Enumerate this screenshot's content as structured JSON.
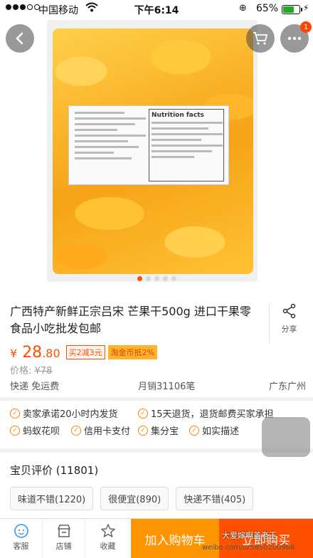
{
  "status_bar": {
    "carrier": "中国移动",
    "time": "下午6:14",
    "battery": "65%"
  },
  "nav": {
    "cart_badge": "1"
  },
  "gallery": {
    "label_title": "Nutrition facts",
    "dot_count": 5,
    "active_dot": 0
  },
  "product": {
    "title": "广西特产新鲜正宗吕宋 芒果干500g 进口干果零食品小吃批发包邮",
    "share_label": "分享",
    "price_symbol": "¥",
    "price_int": "28",
    "price_dec": ".80",
    "promo_1": "买2减3元",
    "promo_2": "淘金币抵2%",
    "orig_label": "价格:",
    "orig_price": "¥78",
    "shipping": "快递 免运费",
    "monthly_sales": "月销31106笔",
    "location": "广东广州"
  },
  "services": [
    "卖家承诺20小时内发货",
    "15天退货，退货邮费买家承担",
    "蚂蚁花呗",
    "信用卡支付",
    "集分宝",
    "如实描述"
  ],
  "reviews": {
    "title": "宝贝评价 (11801)",
    "tags": [
      "味道不错(1220)",
      "很便宜(890)",
      "快递不错(405)"
    ]
  },
  "bottom_bar": {
    "service_label": "客服",
    "shop_label": "店铺",
    "fav_label": "收藏",
    "add_cart": "加入购物车",
    "buy_now": "立即购买"
  },
  "watermark": {
    "text": "大爱嫁啊盖老王",
    "url": "weibo.com/u/5850200966"
  },
  "colors": {
    "accent": "#ff5000",
    "cart": "#ff9402"
  }
}
